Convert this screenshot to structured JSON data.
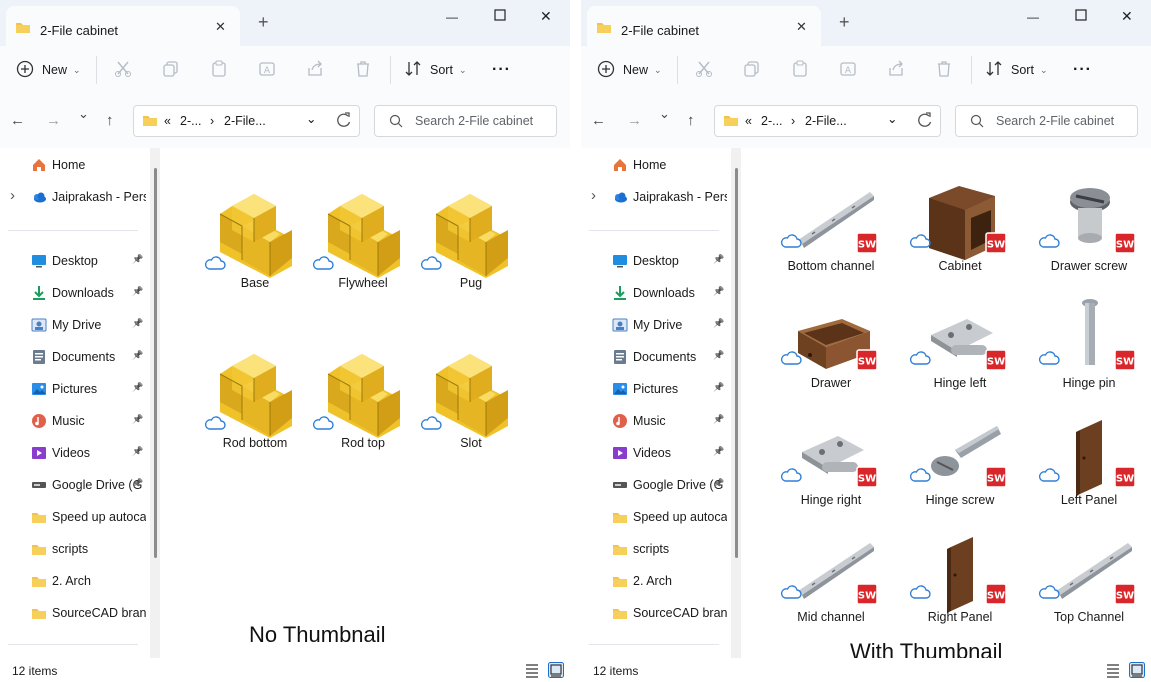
{
  "windows": [
    {
      "id": "left",
      "tab_title": "2-File cabinet",
      "toolbar": {
        "new_label": "New",
        "sort_label": "Sort",
        "more_label": "···"
      },
      "address": {
        "prefix": "«",
        "crumb1": "2-...",
        "crumb2": "2-File..."
      },
      "search_placeholder": "Search 2-File cabinet",
      "sidebar": [
        {
          "label": "Home",
          "icon": "home-icon"
        },
        {
          "label": "Jaiprakash - Perso",
          "icon": "onedrive-icon"
        },
        {
          "label": "Desktop",
          "icon": "desktop-icon"
        },
        {
          "label": "Downloads",
          "icon": "downloads-icon"
        },
        {
          "label": "My Drive",
          "icon": "drive-icon"
        },
        {
          "label": "Documents",
          "icon": "documents-icon"
        },
        {
          "label": "Pictures",
          "icon": "pictures-icon"
        },
        {
          "label": "Music",
          "icon": "music-icon"
        },
        {
          "label": "Videos",
          "icon": "videos-icon"
        },
        {
          "label": "Google Drive (G",
          "icon": "google-drive-icon"
        },
        {
          "label": "Speed up autocad",
          "icon": "folder-icon"
        },
        {
          "label": "scripts",
          "icon": "folder-icon"
        },
        {
          "label": "2. Arch",
          "icon": "folder-icon"
        },
        {
          "label": "SourceCAD brand",
          "icon": "folder-icon"
        }
      ],
      "files": [
        {
          "label": "Base",
          "thumb": "generic"
        },
        {
          "label": "Flywheel",
          "thumb": "generic"
        },
        {
          "label": "Pug",
          "thumb": "generic"
        },
        {
          "label": "Rod bottom",
          "thumb": "generic"
        },
        {
          "label": "Rod top",
          "thumb": "generic"
        },
        {
          "label": "Slot",
          "thumb": "generic"
        }
      ],
      "caption": "No Thumbnail",
      "status": "12 items"
    },
    {
      "id": "right",
      "tab_title": "2-File cabinet",
      "toolbar": {
        "new_label": "New",
        "sort_label": "Sort",
        "more_label": "···"
      },
      "address": {
        "prefix": "«",
        "crumb1": "2-...",
        "crumb2": "2-File..."
      },
      "search_placeholder": "Search 2-File cabinet",
      "sidebar": [
        {
          "label": "Home",
          "icon": "home-icon"
        },
        {
          "label": "Jaiprakash - Perso",
          "icon": "onedrive-icon"
        },
        {
          "label": "Desktop",
          "icon": "desktop-icon"
        },
        {
          "label": "Downloads",
          "icon": "downloads-icon"
        },
        {
          "label": "My Drive",
          "icon": "drive-icon"
        },
        {
          "label": "Documents",
          "icon": "documents-icon"
        },
        {
          "label": "Pictures",
          "icon": "pictures-icon"
        },
        {
          "label": "Music",
          "icon": "music-icon"
        },
        {
          "label": "Videos",
          "icon": "videos-icon"
        },
        {
          "label": "Google Drive (G",
          "icon": "google-drive-icon"
        },
        {
          "label": "Speed up autocad",
          "icon": "folder-icon"
        },
        {
          "label": "scripts",
          "icon": "folder-icon"
        },
        {
          "label": "2. Arch",
          "icon": "folder-icon"
        },
        {
          "label": "SourceCAD brand",
          "icon": "folder-icon"
        }
      ],
      "files": [
        {
          "label": "Bottom channel",
          "thumb": "channel"
        },
        {
          "label": "Cabinet",
          "thumb": "cabinet"
        },
        {
          "label": "Drawer screw",
          "thumb": "screw"
        },
        {
          "label": "Drawer",
          "thumb": "drawer"
        },
        {
          "label": "Hinge left",
          "thumb": "hinge"
        },
        {
          "label": "Hinge pin",
          "thumb": "pin"
        },
        {
          "label": "Hinge right",
          "thumb": "hinge"
        },
        {
          "label": "Hinge screw",
          "thumb": "bolt"
        },
        {
          "label": "Left Panel",
          "thumb": "panel"
        },
        {
          "label": "Mid channel",
          "thumb": "channel"
        },
        {
          "label": "Right Panel",
          "thumb": "panel"
        },
        {
          "label": "Top Channel",
          "thumb": "channel"
        }
      ],
      "caption": "With Thumbnail",
      "status": "12 items"
    }
  ],
  "colors": {
    "titlebar_bg": "#eef3f9",
    "folder_yellow": "#f5c542",
    "solidworks_red": "#d8262a",
    "cloud_blue": "#2f7fd6"
  }
}
